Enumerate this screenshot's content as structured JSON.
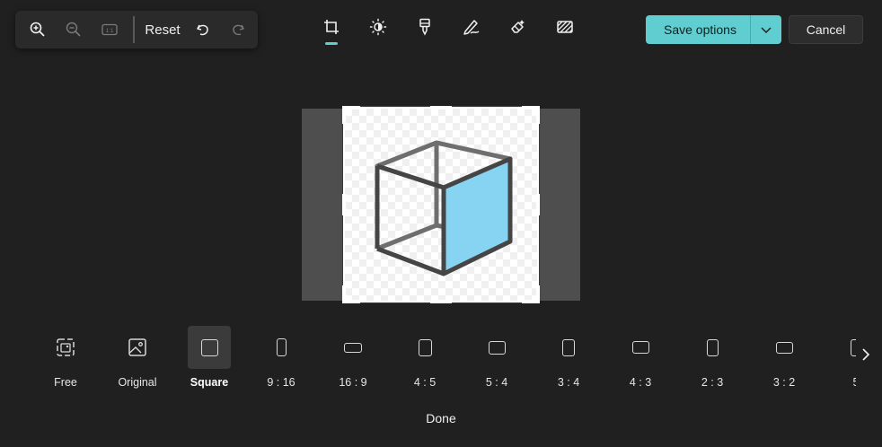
{
  "zoom_toolbar": {
    "zoom_in_icon": "zoom-in-icon",
    "zoom_out_icon": "zoom-out-icon",
    "actual_size_icon": "actual-size-icon",
    "reset_label": "Reset",
    "undo_icon": "undo-icon",
    "redo_icon": "redo-icon"
  },
  "tools": [
    {
      "name": "crop",
      "icon": "crop-icon",
      "active": true
    },
    {
      "name": "adjustment",
      "icon": "brightness-icon",
      "active": false
    },
    {
      "name": "filter",
      "icon": "filter-icon",
      "active": false
    },
    {
      "name": "markup",
      "icon": "pen-icon",
      "active": false
    },
    {
      "name": "erase",
      "icon": "eraser-icon",
      "active": false
    },
    {
      "name": "background",
      "icon": "background-icon",
      "active": false
    }
  ],
  "actions": {
    "save_label": "Save options",
    "cancel_label": "Cancel",
    "done_label": "Done"
  },
  "colors": {
    "accent": "#60cdd0",
    "background": "#202020",
    "cube_face": "#87d4f2"
  },
  "ratios": [
    {
      "label": "Free",
      "selected": false
    },
    {
      "label": "Original",
      "selected": false
    },
    {
      "label": "Square",
      "selected": true
    },
    {
      "label": "9 : 16",
      "selected": false
    },
    {
      "label": "16 : 9",
      "selected": false
    },
    {
      "label": "4 : 5",
      "selected": false
    },
    {
      "label": "5 : 4",
      "selected": false
    },
    {
      "label": "3 : 4",
      "selected": false
    },
    {
      "label": "4 : 3",
      "selected": false
    },
    {
      "label": "2 : 3",
      "selected": false
    },
    {
      "label": "3 : 2",
      "selected": false
    },
    {
      "label": "5",
      "selected": false
    }
  ]
}
